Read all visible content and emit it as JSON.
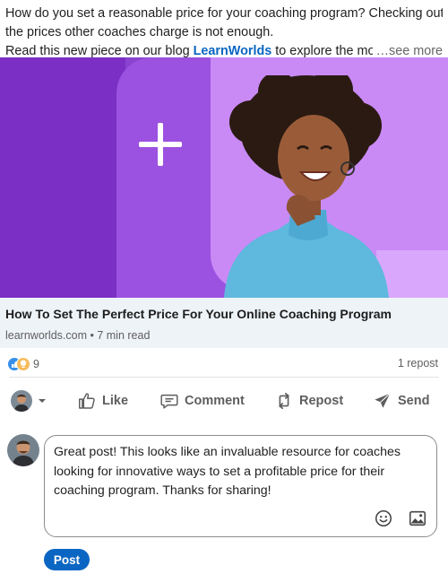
{
  "post": {
    "line1": "How do you set a reasonable price for your coaching program? Checking out",
    "line2": "the prices other coaches charge is not enough.",
    "line3_before": "Read this new piece on our blog ",
    "line3_mention": "LearnWorlds",
    "line3_after": " to explore the most popular",
    "see_more": "…see more"
  },
  "link_card": {
    "title": "How To Set The Perfect Price For Your Online Coaching Program",
    "source": "learnworlds.com",
    "separator": " • ",
    "read_time": "7 min read"
  },
  "social_counts": {
    "reactions": "9",
    "reposts": "1 repost"
  },
  "actions": {
    "like": "Like",
    "comment": "Comment",
    "repost": "Repost",
    "send": "Send"
  },
  "comment_box": {
    "text": "Great post! This looks like an invaluable resource for coaches looking for innovative ways to set a profitable price for their coaching program. Thanks for sharing!"
  },
  "post_button": "Post",
  "colors": {
    "accent": "#0a66c2",
    "hero_purple": "#8a42d0",
    "hero_light": "#c98af6",
    "card_bg": "#eef3f8"
  },
  "icons": [
    "plus-icon",
    "like-reaction-icon",
    "insightful-reaction-icon",
    "chevron-down-icon",
    "like-icon",
    "comment-icon",
    "repost-icon",
    "send-icon",
    "emoji-icon",
    "image-icon"
  ]
}
